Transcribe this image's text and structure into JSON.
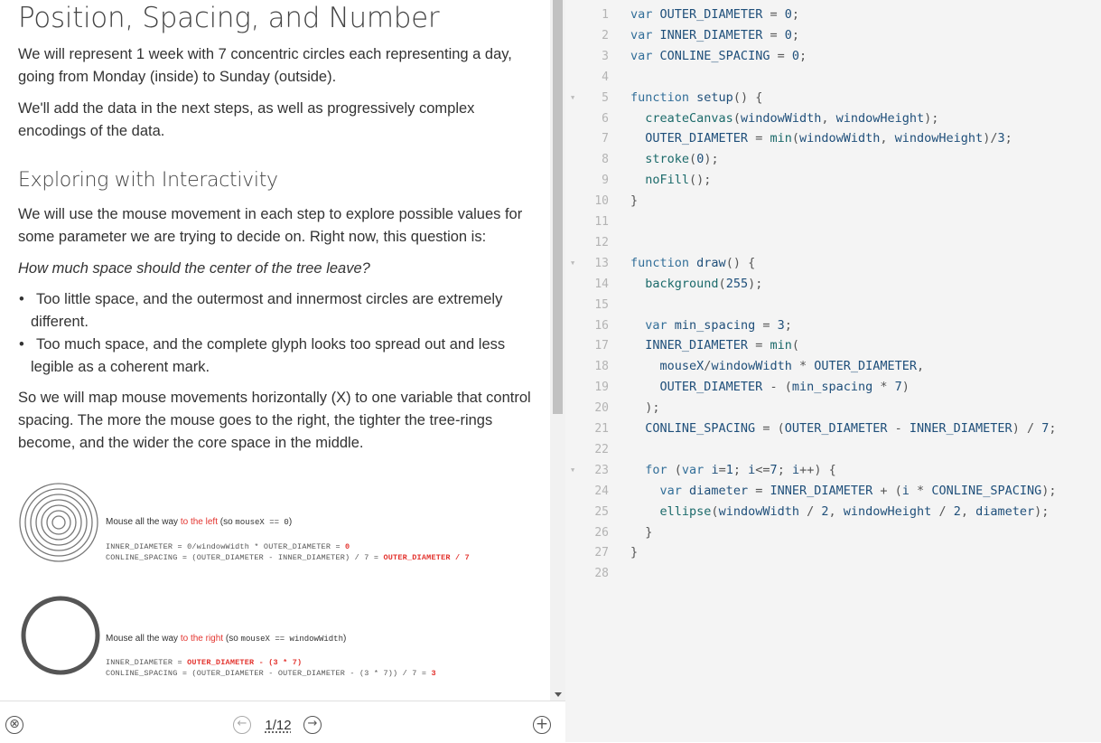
{
  "tutorial": {
    "title": "Position, Spacing, and Number",
    "intro_p1": "We will represent 1 week with 7 concentric circles each representing a day, going from Monday (inside) to Sunday (outside).",
    "intro_p2": "We'll add the data in the next steps, as well as progressively complex encodings of the data.",
    "section_title": "Exploring with Interactivity",
    "p3": "We will use the mouse movement in each step to explore possible values for some parameter we are trying to decide on. Right now, this question is:",
    "question": "How much space should the center of the tree leave?",
    "bullets": [
      "Too little space, and the outermost and innermost circles are extremely different.",
      "Too much space, and the complete glyph looks too spread out and less legible as a coherent mark."
    ],
    "p4": "So we will map mouse movements horizontally (X) to one variable that control spacing. The more the mouse goes to the right, the tighter the tree-rings become, and the wider the core space in the middle.",
    "illustration_left": {
      "caption_pre": "Mouse all the way ",
      "caption_red": "to the left",
      "caption_mid": " (so ",
      "caption_code": "mouseX == 0",
      "caption_post": ")",
      "line1": "INNER_DIAMETER = 0/windowWidth * OUTER_DIAMETER = ",
      "line1_red": "0",
      "line2": "CONLINE_SPACING = (OUTER_DIAMETER - INNER_DIAMETER) / 7 = ",
      "line2_red": "OUTER_DIAMETER / 7"
    },
    "illustration_right": {
      "caption_pre": "Mouse all the way ",
      "caption_red": "to the right",
      "caption_mid": " (so ",
      "caption_code": "mouseX == windowWidth",
      "caption_post": ")",
      "line1": "INNER_DIAMETER = ",
      "line1_red": "OUTER_DIAMETER - (3 * 7)",
      "line2": "CONLINE_SPACING = (OUTER_DIAMETER - OUTER_DIAMETER - (3 * 7)) / 7 = ",
      "line2_red": "3"
    }
  },
  "toolbar": {
    "close_icon": "⊗",
    "prev_icon": "←",
    "page": "1/12",
    "next_icon": "→",
    "add_icon": "+"
  },
  "editor": {
    "line_numbers": [
      "1",
      "2",
      "3",
      "4",
      "5",
      "6",
      "7",
      "8",
      "9",
      "10",
      "11",
      "12",
      "13",
      "14",
      "15",
      "16",
      "17",
      "18",
      "19",
      "20",
      "21",
      "22",
      "23",
      "24",
      "25",
      "26",
      "27",
      "28"
    ],
    "fold_markers": [
      "▼",
      "▼",
      "▼"
    ],
    "lines": [
      "var OUTER_DIAMETER = 0;",
      "var INNER_DIAMETER = 0;",
      "var CONLINE_SPACING = 0;",
      "",
      "function setup() {",
      "  createCanvas(windowWidth, windowHeight);",
      "  OUTER_DIAMETER = min(windowWidth, windowHeight)/3;",
      "  stroke(0);",
      "  noFill();",
      "}",
      "",
      "",
      "function draw() {",
      "  background(255);",
      "",
      "  var min_spacing = 3;",
      "  INNER_DIAMETER = min(",
      "    mouseX/windowWidth * OUTER_DIAMETER,",
      "    OUTER_DIAMETER - (min_spacing * 7)",
      "  );",
      "  CONLINE_SPACING = (OUTER_DIAMETER - INNER_DIAMETER) / 7;",
      "",
      "  for (var i=1; i<=7; i++) {",
      "    var diameter = INNER_DIAMETER + (i * CONLINE_SPACING);",
      "    ellipse(windowWidth / 2, windowHeight / 2, diameter);",
      "  }",
      "}",
      ""
    ]
  },
  "colors": {
    "accent_red": "#e3342f",
    "editor_bg": "#f4f4f4",
    "keyword": "#336f99"
  }
}
